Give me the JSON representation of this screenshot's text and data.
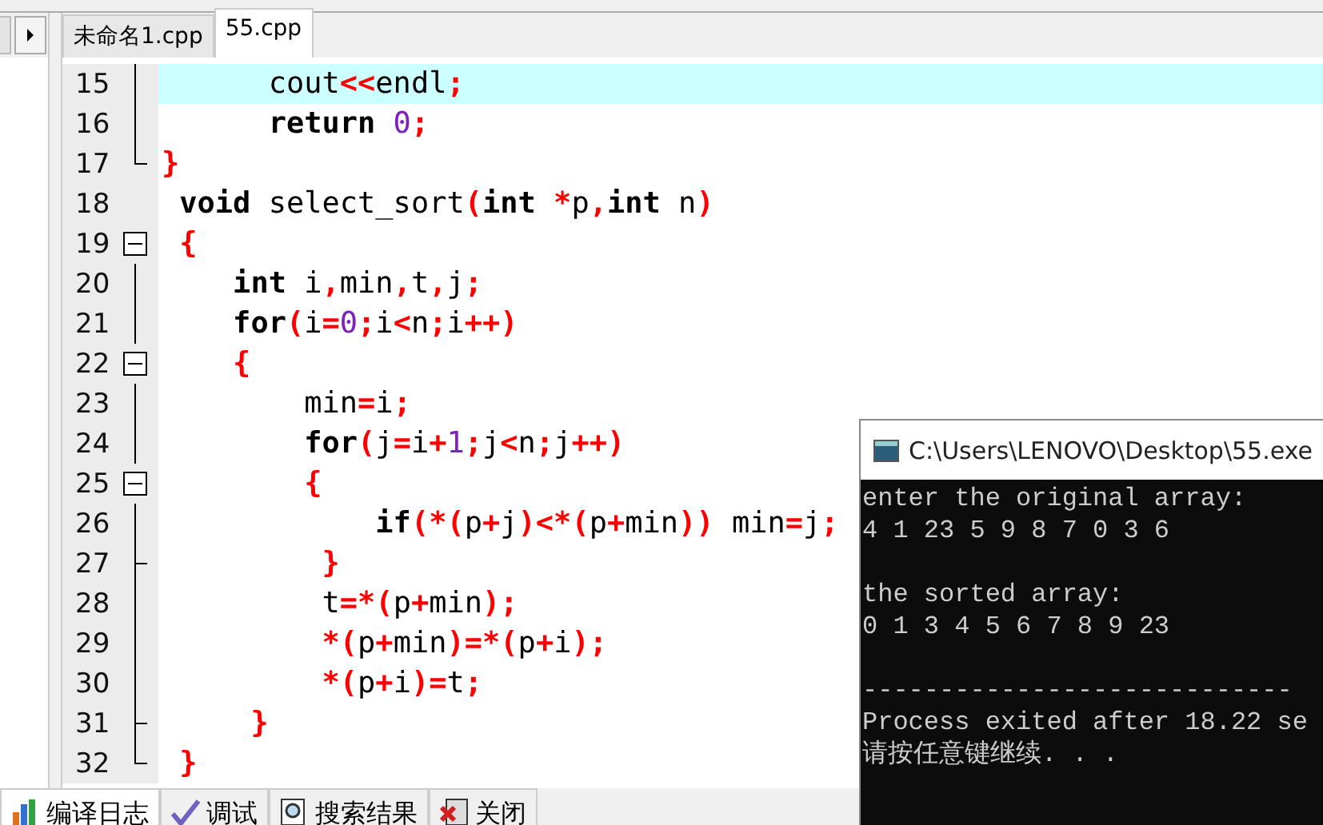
{
  "editor_tabs": [
    {
      "label": "未命名1.cpp",
      "selected": false
    },
    {
      "label": "55.cpp",
      "selected": true
    }
  ],
  "code": {
    "lines": [
      {
        "number": "15",
        "kind": "line",
        "current": true,
        "tokens": [
          {
            "t": "      cout",
            "kind": "id"
          },
          {
            "t": "<<",
            "kind": "op"
          },
          {
            "t": "endl",
            "kind": "id"
          },
          {
            "t": ";",
            "kind": "op"
          }
        ]
      },
      {
        "number": "16",
        "kind": "line",
        "current": false,
        "tokens": [
          {
            "t": "      return",
            "kind": "kw"
          },
          {
            "t": " 0",
            "kind": "num"
          },
          {
            "t": ";",
            "kind": "op"
          }
        ]
      },
      {
        "number": "17",
        "kind": "end",
        "current": false,
        "tokens": [
          {
            "t": "}",
            "kind": "op"
          }
        ]
      },
      {
        "number": "18",
        "kind": "none",
        "current": false,
        "tokens": [
          {
            "t": " void",
            "kind": "kw"
          },
          {
            "t": " select_sort",
            "kind": "id"
          },
          {
            "t": "(",
            "kind": "op"
          },
          {
            "t": "int",
            "kind": "kw"
          },
          {
            "t": " *",
            "kind": "op"
          },
          {
            "t": "p",
            "kind": "id"
          },
          {
            "t": ",",
            "kind": "op"
          },
          {
            "t": "int",
            "kind": "kw"
          },
          {
            "t": " n",
            "kind": "id"
          },
          {
            "t": ")",
            "kind": "op"
          }
        ]
      },
      {
        "number": "19",
        "kind": "open",
        "current": false,
        "tokens": [
          {
            "t": " {",
            "kind": "op"
          }
        ]
      },
      {
        "number": "20",
        "kind": "line",
        "current": false,
        "tokens": [
          {
            "t": "    int",
            "kind": "kw"
          },
          {
            "t": " i",
            "kind": "id"
          },
          {
            "t": ",",
            "kind": "op"
          },
          {
            "t": "min",
            "kind": "id"
          },
          {
            "t": ",",
            "kind": "op"
          },
          {
            "t": "t",
            "kind": "id"
          },
          {
            "t": ",",
            "kind": "op"
          },
          {
            "t": "j",
            "kind": "id"
          },
          {
            "t": ";",
            "kind": "op"
          }
        ]
      },
      {
        "number": "21",
        "kind": "line",
        "current": false,
        "tokens": [
          {
            "t": "    for",
            "kind": "kw"
          },
          {
            "t": "(",
            "kind": "op"
          },
          {
            "t": "i",
            "kind": "id"
          },
          {
            "t": "=",
            "kind": "op"
          },
          {
            "t": "0",
            "kind": "num"
          },
          {
            "t": ";",
            "kind": "op"
          },
          {
            "t": "i",
            "kind": "id"
          },
          {
            "t": "<",
            "kind": "op"
          },
          {
            "t": "n",
            "kind": "id"
          },
          {
            "t": ";",
            "kind": "op"
          },
          {
            "t": "i",
            "kind": "id"
          },
          {
            "t": "++)",
            "kind": "op"
          }
        ]
      },
      {
        "number": "22",
        "kind": "open",
        "current": false,
        "tokens": [
          {
            "t": "    {",
            "kind": "op"
          }
        ]
      },
      {
        "number": "23",
        "kind": "line",
        "current": false,
        "tokens": [
          {
            "t": "        min",
            "kind": "id"
          },
          {
            "t": "=",
            "kind": "op"
          },
          {
            "t": "i",
            "kind": "id"
          },
          {
            "t": ";",
            "kind": "op"
          }
        ]
      },
      {
        "number": "24",
        "kind": "line",
        "current": false,
        "tokens": [
          {
            "t": "        for",
            "kind": "kw"
          },
          {
            "t": "(",
            "kind": "op"
          },
          {
            "t": "j",
            "kind": "id"
          },
          {
            "t": "=",
            "kind": "op"
          },
          {
            "t": "i",
            "kind": "id"
          },
          {
            "t": "+",
            "kind": "op"
          },
          {
            "t": "1",
            "kind": "num"
          },
          {
            "t": ";",
            "kind": "op"
          },
          {
            "t": "j",
            "kind": "id"
          },
          {
            "t": "<",
            "kind": "op"
          },
          {
            "t": "n",
            "kind": "id"
          },
          {
            "t": ";",
            "kind": "op"
          },
          {
            "t": "j",
            "kind": "id"
          },
          {
            "t": "++)",
            "kind": "op"
          }
        ]
      },
      {
        "number": "25",
        "kind": "open",
        "current": false,
        "tokens": [
          {
            "t": "        {",
            "kind": "op"
          }
        ]
      },
      {
        "number": "26",
        "kind": "line",
        "current": false,
        "tokens": [
          {
            "t": "            if",
            "kind": "kw"
          },
          {
            "t": "(*(",
            "kind": "op"
          },
          {
            "t": "p",
            "kind": "id"
          },
          {
            "t": "+",
            "kind": "op"
          },
          {
            "t": "j",
            "kind": "id"
          },
          {
            "t": ")<*(",
            "kind": "op"
          },
          {
            "t": "p",
            "kind": "id"
          },
          {
            "t": "+",
            "kind": "op"
          },
          {
            "t": "min",
            "kind": "id"
          },
          {
            "t": "))",
            "kind": "op"
          },
          {
            "t": " min",
            "kind": "id"
          },
          {
            "t": "=",
            "kind": "op"
          },
          {
            "t": "j",
            "kind": "id"
          },
          {
            "t": ";",
            "kind": "op"
          }
        ]
      },
      {
        "number": "27",
        "kind": "branch",
        "current": false,
        "tokens": [
          {
            "t": "         }",
            "kind": "op"
          }
        ]
      },
      {
        "number": "28",
        "kind": "line",
        "current": false,
        "tokens": [
          {
            "t": "         t",
            "kind": "id"
          },
          {
            "t": "=*(",
            "kind": "op"
          },
          {
            "t": "p",
            "kind": "id"
          },
          {
            "t": "+",
            "kind": "op"
          },
          {
            "t": "min",
            "kind": "id"
          },
          {
            "t": ");",
            "kind": "op"
          }
        ]
      },
      {
        "number": "29",
        "kind": "line",
        "current": false,
        "tokens": [
          {
            "t": "         *(",
            "kind": "op"
          },
          {
            "t": "p",
            "kind": "id"
          },
          {
            "t": "+",
            "kind": "op"
          },
          {
            "t": "min",
            "kind": "id"
          },
          {
            "t": ")=*(",
            "kind": "op"
          },
          {
            "t": "p",
            "kind": "id"
          },
          {
            "t": "+",
            "kind": "op"
          },
          {
            "t": "i",
            "kind": "id"
          },
          {
            "t": ");",
            "kind": "op"
          }
        ]
      },
      {
        "number": "30",
        "kind": "line",
        "current": false,
        "tokens": [
          {
            "t": "         *(",
            "kind": "op"
          },
          {
            "t": "p",
            "kind": "id"
          },
          {
            "t": "+",
            "kind": "op"
          },
          {
            "t": "i",
            "kind": "id"
          },
          {
            "t": ")=",
            "kind": "op"
          },
          {
            "t": "t",
            "kind": "id"
          },
          {
            "t": ";",
            "kind": "op"
          }
        ]
      },
      {
        "number": "31",
        "kind": "branch",
        "current": false,
        "tokens": [
          {
            "t": "     }",
            "kind": "op"
          }
        ]
      },
      {
        "number": "32",
        "kind": "end",
        "current": false,
        "tokens": [
          {
            "t": " }",
            "kind": "op"
          }
        ]
      }
    ]
  },
  "bottom_tabs": [
    {
      "label": "编译日志",
      "kind": "chart",
      "selected": true
    },
    {
      "label": "调试",
      "kind": "check",
      "selected": false
    },
    {
      "label": "搜索结果",
      "kind": "search",
      "selected": false
    },
    {
      "label": "关闭",
      "kind": "close",
      "selected": false
    }
  ],
  "console": {
    "title": "C:\\Users\\LENOVO\\Desktop\\55.exe",
    "blocks": [
      [
        "enter the original array:",
        "4 1 23 5 9 8 7 0 3 6"
      ],
      [
        "the sorted array:",
        "0 1 3 4 5 6 7 8 9 23"
      ],
      [
        "----------------------------",
        "Process exited after 18.22 se",
        "请按任意键继续. . ."
      ]
    ]
  }
}
